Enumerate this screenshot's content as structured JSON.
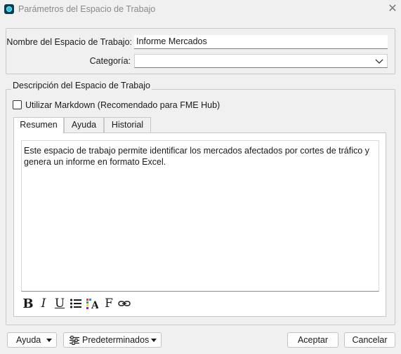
{
  "window": {
    "title": "Parámetros del Espacio de Trabajo",
    "close_glyph": "✕"
  },
  "general": {
    "name_label": "Nombre del Espacio de Trabajo:",
    "name_value": "Informe Mercados",
    "category_label": "Categoría:",
    "category_value": ""
  },
  "description": {
    "group_title": "Descripción del Espacio de Trabajo",
    "markdown_label": "Utilizar Markdown (Recomendado para FME Hub)",
    "markdown_checked": false,
    "tabs": [
      {
        "label": "Resumen",
        "active": true
      },
      {
        "label": "Ayuda",
        "active": false
      },
      {
        "label": "Historial",
        "active": false
      }
    ],
    "summary_text": "Este espacio de trabajo permite identificar los mercados afectados por cortes de tráfico y genera un informe en formato Excel.",
    "format_toolbar": [
      {
        "name": "bold-icon",
        "glyph": "B"
      },
      {
        "name": "italic-icon",
        "glyph": "I"
      },
      {
        "name": "underline-icon",
        "glyph": "U"
      },
      {
        "name": "bullet-list-icon",
        "glyph": ""
      },
      {
        "name": "text-color-icon",
        "glyph": "A"
      },
      {
        "name": "font-icon",
        "glyph": "F"
      },
      {
        "name": "link-icon",
        "glyph": ""
      }
    ]
  },
  "footer": {
    "help_label": "Ayuda",
    "defaults_label": "Predeterminados",
    "ok_label": "Aceptar",
    "cancel_label": "Cancelar"
  },
  "colors": {
    "background": "#f0f0f0",
    "app_icon_bg": "#0d3b52",
    "app_icon_accent": "#2ec4d6",
    "title_text": "#8a8a8a"
  }
}
